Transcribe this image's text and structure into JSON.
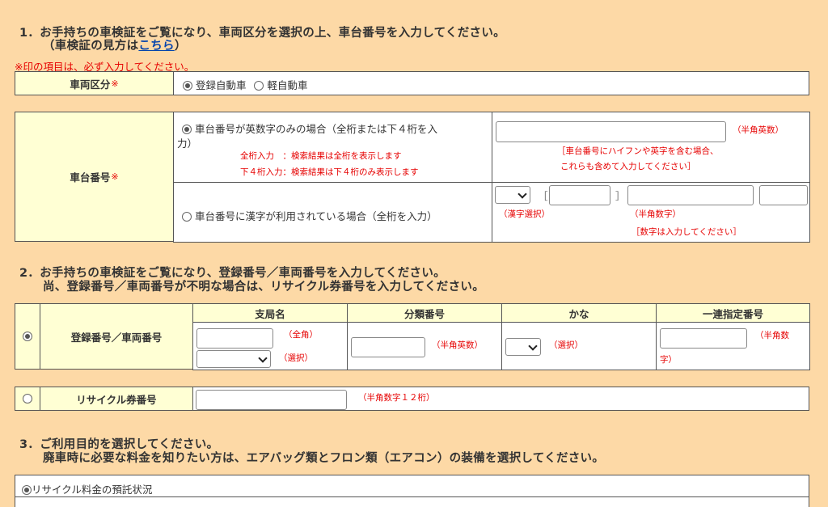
{
  "section1": {
    "heading_line1": "1．お手持ちの車検証をご覧になり、車両区分を選択の上、車台番号を入力してください。",
    "heading_line2_prefix": "（車検証の見方は",
    "heading_link": "こちら",
    "heading_line2_suffix": "）",
    "required_note": "※印の項目は、必ず入力してください。",
    "vehicle_type_label": "車両区分",
    "required_mark": "※",
    "vehicle_type_options": [
      "登録自動車",
      "軽自動車"
    ],
    "chassis_label": "車台番号",
    "option_alnum_line1": "車台番号が英数字のみの場合（全桁または下４桁を入",
    "option_alnum_line2": "力）",
    "hint_full": "全桁入力　：検索結果は全桁を表示します",
    "hint_last4": "下４桁入力：検索結果は下４桁のみ表示します",
    "alnum_input_note": "（半角英数）",
    "alnum_note_line1": "［車台番号にハイフンや英字を含む場合、",
    "alnum_note_line2": "これらも含めて入力してください］",
    "option_kanji": "車台番号に漢字が利用されている場合（全桁を入力）",
    "bracket_open": "［",
    "bracket_close": "］",
    "kanji_select_note": "（漢字選択）",
    "kanji_number_note": "（半角数字）",
    "kanji_number_note2": "［数字は入力してください］"
  },
  "section2": {
    "heading_line1": "2．お手持ちの車検証をご覧になり、登録番号／車両番号を入力してください。",
    "heading_line2": "尚、登録番号／車両番号が不明な場合は、リサイクル券番号を入力してください。",
    "reg_label": "登録番号／車両番号",
    "columns": [
      "支局名",
      "分類番号",
      "かな",
      "一連指定番号"
    ],
    "branch_note_fullwidth": "（全角）",
    "branch_note_select": "（選択）",
    "class_note": "（半角英数）",
    "kana_note": "（選択）",
    "serial_note_line1": "（半角数",
    "serial_note_line2": "字）",
    "recycle_label": "リサイクル券番号",
    "recycle_note": "（半角数字１２桁）"
  },
  "section3": {
    "heading_line1": "3．ご利用目的を選択してください。",
    "heading_line2": "廃車時に必要な料金を知りたい方は、エアバッグ類とフロン類（エアコン）の装備を選択してください。",
    "option1": "リサイクル料金の預託状況"
  }
}
